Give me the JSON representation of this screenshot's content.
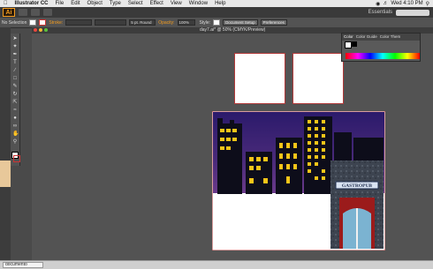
{
  "menubar": {
    "apple": "",
    "app_name": "Illustrator CC",
    "items": [
      "File",
      "Edit",
      "Object",
      "Type",
      "Select",
      "Effect",
      "View",
      "Window",
      "Help"
    ],
    "clock": "Wed 4:10 PM"
  },
  "appbar": {
    "logo": "Ai",
    "workspace": "Essentials"
  },
  "controlbar": {
    "selection": "No Selection",
    "stroke_label": "Stroke:",
    "brush_value": "5 pt. Round",
    "opacity_label": "Opacity:",
    "opacity_value": "100%",
    "style_label": "Style:",
    "doc_setup": "Document Setup",
    "preferences": "Preferences"
  },
  "document": {
    "tab_title": "day7.ai* @ 50% (CMYK/Preview)"
  },
  "color_panel": {
    "tabs": [
      "Color",
      "Color Guide",
      "Color Them"
    ]
  },
  "scene": {
    "pub_sign": "GASTROPUB"
  },
  "dock": {
    "doc_label": "documento"
  },
  "colors": {
    "accent": "#f39c1f",
    "artboard_border": "#b23a3a",
    "window_yellow": "#f5c518"
  }
}
